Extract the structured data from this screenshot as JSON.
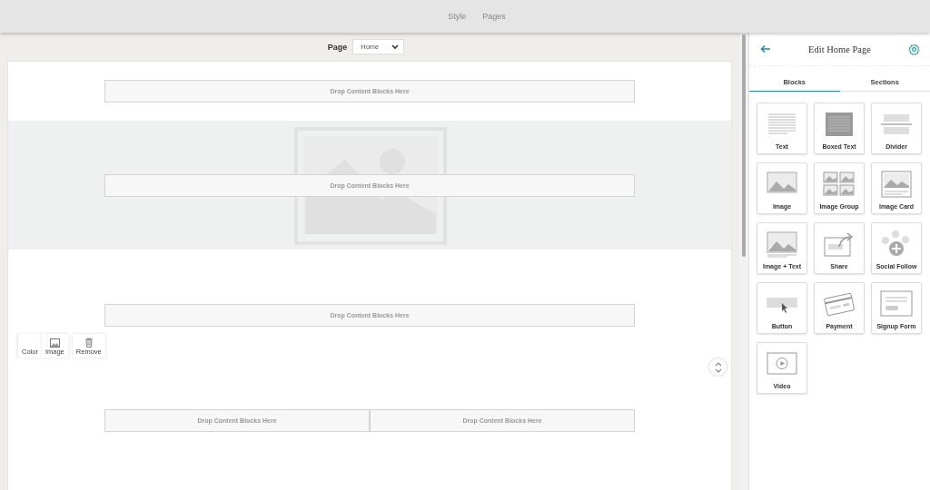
{
  "top_nav": [
    {
      "label": "Style"
    },
    {
      "label": "Pages"
    }
  ],
  "page_selector": {
    "label": "Page",
    "value": "Home"
  },
  "sections": [
    {
      "kind": "plain",
      "drop_zones": [
        "Drop Content Blocks Here"
      ]
    },
    {
      "kind": "image",
      "drop_zones": [
        "Drop Content Blocks Here"
      ]
    },
    {
      "kind": "plain",
      "drop_zones": [
        "Drop Content Blocks Here"
      ]
    },
    {
      "kind": "plain",
      "drop_zones": [
        "Drop Content Blocks Here",
        "Drop Content Blocks Here"
      ]
    }
  ],
  "section_toolbar": [
    {
      "kind": "color",
      "label": "Color"
    },
    {
      "kind": "image",
      "label": "Image"
    },
    {
      "kind": "remove",
      "label": "Remove"
    }
  ],
  "panel": {
    "title": "Edit Home Page",
    "tabs": [
      {
        "label": "Blocks",
        "selected": true
      },
      {
        "label": "Sections",
        "selected": false
      }
    ],
    "blocks": [
      {
        "kind": "text",
        "label": "Text"
      },
      {
        "kind": "boxed",
        "label": "Boxed Text"
      },
      {
        "kind": "divider",
        "label": "Divider"
      },
      {
        "kind": "image",
        "label": "Image"
      },
      {
        "kind": "group",
        "label": "Image Group"
      },
      {
        "kind": "card",
        "label": "Image Card"
      },
      {
        "kind": "imagetext",
        "label": "Image + Text"
      },
      {
        "kind": "share",
        "label": "Share"
      },
      {
        "kind": "social",
        "label": "Social Follow"
      },
      {
        "kind": "button",
        "label": "Button"
      },
      {
        "kind": "payment",
        "label": "Payment"
      },
      {
        "kind": "signup",
        "label": "Signup Form"
      },
      {
        "kind": "video",
        "label": "Video"
      }
    ]
  }
}
